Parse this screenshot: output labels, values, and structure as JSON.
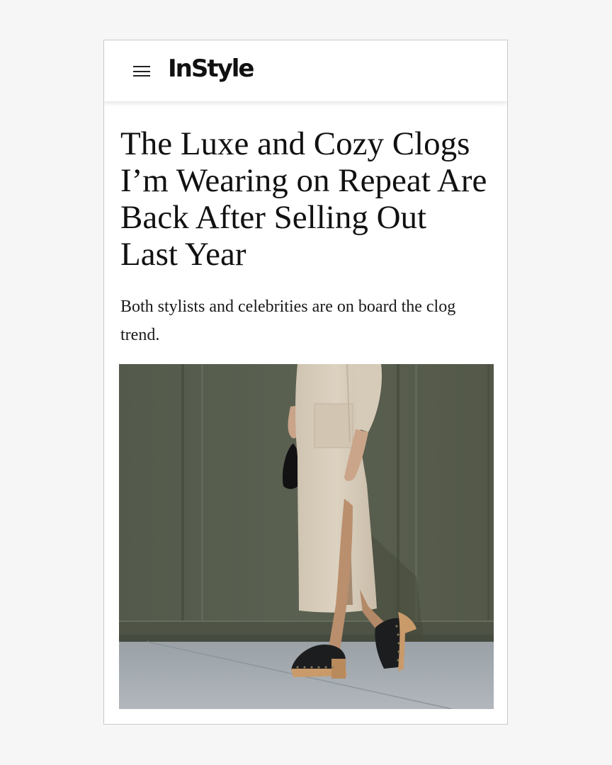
{
  "header": {
    "menu_icon": "hamburger-menu-icon",
    "logo_text": "InStyle"
  },
  "article": {
    "headline": "The Luxe and Cozy Clogs I’m Wearing on Repeat Are Back After Selling Out Last Year",
    "dek": "Both stylists and celebrities are on board the clog trend."
  },
  "colors": {
    "background": "#f6f6f6",
    "wall": "#575d4d",
    "sidewalk": "#a5abb0",
    "knit": "#d7cbb9",
    "clog_leather": "#1c1d1f",
    "clog_wood": "#c99a6a"
  }
}
